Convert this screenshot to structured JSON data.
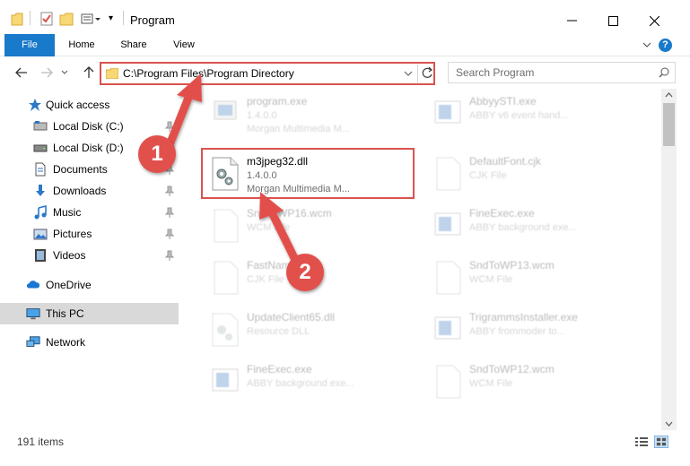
{
  "window": {
    "title": "Program"
  },
  "ribbon": {
    "tabs": [
      {
        "label": "File"
      },
      {
        "label": "Home"
      },
      {
        "label": "Share"
      },
      {
        "label": "View"
      }
    ],
    "help_label": "?"
  },
  "address": {
    "path": "C:\\Program Files\\Program Directory"
  },
  "search": {
    "placeholder": "Search Program"
  },
  "sidebar": {
    "items": [
      {
        "label": "Quick access",
        "icon": "star-icon"
      },
      {
        "label": "Local Disk (C:)",
        "icon": "drive-icon"
      },
      {
        "label": "Local Disk (D:)",
        "icon": "drive-icon"
      },
      {
        "label": "Documents",
        "icon": "documents-icon"
      },
      {
        "label": "Downloads",
        "icon": "download-icon"
      },
      {
        "label": "Music",
        "icon": "music-icon"
      },
      {
        "label": "Pictures",
        "icon": "pictures-icon"
      },
      {
        "label": "Videos",
        "icon": "videos-icon"
      },
      {
        "label": "OneDrive",
        "icon": "cloud-icon"
      },
      {
        "label": "This PC",
        "icon": "computer-icon"
      },
      {
        "label": "Network",
        "icon": "network-icon"
      }
    ]
  },
  "files": [
    {
      "name": "program.exe",
      "version": "1.4.0.0",
      "desc": "Morgan Multimedia M...",
      "icon": "exe-icon"
    },
    {
      "name": "AbbyySTI.exe",
      "version": "",
      "desc": "ABBY v6 event hand...",
      "icon": "exe-icon"
    },
    {
      "name": "m3jpeg32.dll",
      "version": "1.4.0.0",
      "desc": "Morgan Multimedia M...",
      "icon": "dll-gear-icon"
    },
    {
      "name": "DefaultFont.cjk",
      "version": "",
      "desc": "CJK File",
      "icon": "blank-file-icon"
    },
    {
      "name": "SndToWP16.wcm",
      "version": "",
      "desc": "WCM File",
      "icon": "blank-file-icon"
    },
    {
      "name": "FineExec.exe",
      "version": "",
      "desc": "ABBY background exe...",
      "icon": "exe-icon"
    },
    {
      "name": "FastName.cjk",
      "version": "",
      "desc": "CJK File",
      "icon": "blank-file-icon"
    },
    {
      "name": "SndToWP13.wcm",
      "version": "",
      "desc": "WCM File",
      "icon": "blank-file-icon"
    },
    {
      "name": "UpdateClient65.dll",
      "version": "",
      "desc": "Resource DLL",
      "icon": "dll-gear-icon"
    },
    {
      "name": "TrigrammsInstaller.exe",
      "version": "",
      "desc": "ABBY frommoder to...",
      "icon": "exe-icon"
    },
    {
      "name": "FineExec.exe",
      "version": "",
      "desc": "ABBY background exe...",
      "icon": "exe-icon"
    },
    {
      "name": "SndToWP12.wcm",
      "version": "",
      "desc": "WCM File",
      "icon": "blank-file-icon"
    }
  ],
  "status": {
    "item_count": "191 items"
  },
  "annotations": {
    "step1": "1",
    "step2": "2"
  },
  "colors": {
    "accent": "#1979ca",
    "annotation": "#e2504c",
    "highlight": "#d9534f"
  }
}
